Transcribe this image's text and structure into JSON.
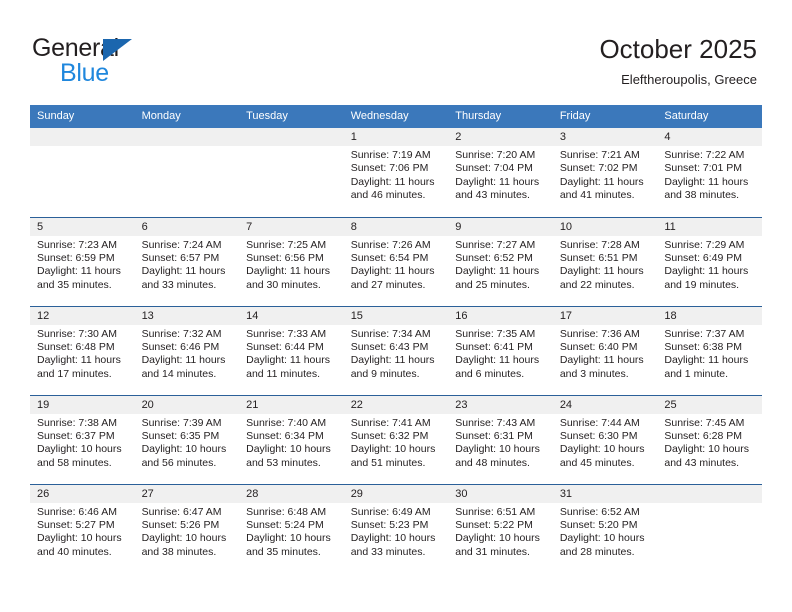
{
  "brand": {
    "name_part1": "General",
    "name_part2": "Blue",
    "triangle_color": "#1b66ae",
    "blue_text_color": "#1f87dd"
  },
  "header": {
    "title": "October 2025",
    "subtitle": "Eleftheroupolis, Greece",
    "header_bg_color": "#3b78bb",
    "row_divider_color": "#2b6099",
    "daynum_bg_color": "#f0f0f0"
  },
  "weekdays": [
    "Sunday",
    "Monday",
    "Tuesday",
    "Wednesday",
    "Thursday",
    "Friday",
    "Saturday"
  ],
  "weeks": [
    [
      {
        "day": "",
        "empty": true
      },
      {
        "day": "",
        "empty": true
      },
      {
        "day": "",
        "empty": true
      },
      {
        "day": "1",
        "sunrise": "Sunrise: 7:19 AM",
        "sunset": "Sunset: 7:06 PM",
        "daylight_l1": "Daylight: 11 hours",
        "daylight_l2": "and 46 minutes."
      },
      {
        "day": "2",
        "sunrise": "Sunrise: 7:20 AM",
        "sunset": "Sunset: 7:04 PM",
        "daylight_l1": "Daylight: 11 hours",
        "daylight_l2": "and 43 minutes."
      },
      {
        "day": "3",
        "sunrise": "Sunrise: 7:21 AM",
        "sunset": "Sunset: 7:02 PM",
        "daylight_l1": "Daylight: 11 hours",
        "daylight_l2": "and 41 minutes."
      },
      {
        "day": "4",
        "sunrise": "Sunrise: 7:22 AM",
        "sunset": "Sunset: 7:01 PM",
        "daylight_l1": "Daylight: 11 hours",
        "daylight_l2": "and 38 minutes."
      }
    ],
    [
      {
        "day": "5",
        "sunrise": "Sunrise: 7:23 AM",
        "sunset": "Sunset: 6:59 PM",
        "daylight_l1": "Daylight: 11 hours",
        "daylight_l2": "and 35 minutes."
      },
      {
        "day": "6",
        "sunrise": "Sunrise: 7:24 AM",
        "sunset": "Sunset: 6:57 PM",
        "daylight_l1": "Daylight: 11 hours",
        "daylight_l2": "and 33 minutes."
      },
      {
        "day": "7",
        "sunrise": "Sunrise: 7:25 AM",
        "sunset": "Sunset: 6:56 PM",
        "daylight_l1": "Daylight: 11 hours",
        "daylight_l2": "and 30 minutes."
      },
      {
        "day": "8",
        "sunrise": "Sunrise: 7:26 AM",
        "sunset": "Sunset: 6:54 PM",
        "daylight_l1": "Daylight: 11 hours",
        "daylight_l2": "and 27 minutes."
      },
      {
        "day": "9",
        "sunrise": "Sunrise: 7:27 AM",
        "sunset": "Sunset: 6:52 PM",
        "daylight_l1": "Daylight: 11 hours",
        "daylight_l2": "and 25 minutes."
      },
      {
        "day": "10",
        "sunrise": "Sunrise: 7:28 AM",
        "sunset": "Sunset: 6:51 PM",
        "daylight_l1": "Daylight: 11 hours",
        "daylight_l2": "and 22 minutes."
      },
      {
        "day": "11",
        "sunrise": "Sunrise: 7:29 AM",
        "sunset": "Sunset: 6:49 PM",
        "daylight_l1": "Daylight: 11 hours",
        "daylight_l2": "and 19 minutes."
      }
    ],
    [
      {
        "day": "12",
        "sunrise": "Sunrise: 7:30 AM",
        "sunset": "Sunset: 6:48 PM",
        "daylight_l1": "Daylight: 11 hours",
        "daylight_l2": "and 17 minutes."
      },
      {
        "day": "13",
        "sunrise": "Sunrise: 7:32 AM",
        "sunset": "Sunset: 6:46 PM",
        "daylight_l1": "Daylight: 11 hours",
        "daylight_l2": "and 14 minutes."
      },
      {
        "day": "14",
        "sunrise": "Sunrise: 7:33 AM",
        "sunset": "Sunset: 6:44 PM",
        "daylight_l1": "Daylight: 11 hours",
        "daylight_l2": "and 11 minutes."
      },
      {
        "day": "15",
        "sunrise": "Sunrise: 7:34 AM",
        "sunset": "Sunset: 6:43 PM",
        "daylight_l1": "Daylight: 11 hours",
        "daylight_l2": "and 9 minutes."
      },
      {
        "day": "16",
        "sunrise": "Sunrise: 7:35 AM",
        "sunset": "Sunset: 6:41 PM",
        "daylight_l1": "Daylight: 11 hours",
        "daylight_l2": "and 6 minutes."
      },
      {
        "day": "17",
        "sunrise": "Sunrise: 7:36 AM",
        "sunset": "Sunset: 6:40 PM",
        "daylight_l1": "Daylight: 11 hours",
        "daylight_l2": "and 3 minutes."
      },
      {
        "day": "18",
        "sunrise": "Sunrise: 7:37 AM",
        "sunset": "Sunset: 6:38 PM",
        "daylight_l1": "Daylight: 11 hours",
        "daylight_l2": "and 1 minute."
      }
    ],
    [
      {
        "day": "19",
        "sunrise": "Sunrise: 7:38 AM",
        "sunset": "Sunset: 6:37 PM",
        "daylight_l1": "Daylight: 10 hours",
        "daylight_l2": "and 58 minutes."
      },
      {
        "day": "20",
        "sunrise": "Sunrise: 7:39 AM",
        "sunset": "Sunset: 6:35 PM",
        "daylight_l1": "Daylight: 10 hours",
        "daylight_l2": "and 56 minutes."
      },
      {
        "day": "21",
        "sunrise": "Sunrise: 7:40 AM",
        "sunset": "Sunset: 6:34 PM",
        "daylight_l1": "Daylight: 10 hours",
        "daylight_l2": "and 53 minutes."
      },
      {
        "day": "22",
        "sunrise": "Sunrise: 7:41 AM",
        "sunset": "Sunset: 6:32 PM",
        "daylight_l1": "Daylight: 10 hours",
        "daylight_l2": "and 51 minutes."
      },
      {
        "day": "23",
        "sunrise": "Sunrise: 7:43 AM",
        "sunset": "Sunset: 6:31 PM",
        "daylight_l1": "Daylight: 10 hours",
        "daylight_l2": "and 48 minutes."
      },
      {
        "day": "24",
        "sunrise": "Sunrise: 7:44 AM",
        "sunset": "Sunset: 6:30 PM",
        "daylight_l1": "Daylight: 10 hours",
        "daylight_l2": "and 45 minutes."
      },
      {
        "day": "25",
        "sunrise": "Sunrise: 7:45 AM",
        "sunset": "Sunset: 6:28 PM",
        "daylight_l1": "Daylight: 10 hours",
        "daylight_l2": "and 43 minutes."
      }
    ],
    [
      {
        "day": "26",
        "sunrise": "Sunrise: 6:46 AM",
        "sunset": "Sunset: 5:27 PM",
        "daylight_l1": "Daylight: 10 hours",
        "daylight_l2": "and 40 minutes."
      },
      {
        "day": "27",
        "sunrise": "Sunrise: 6:47 AM",
        "sunset": "Sunset: 5:26 PM",
        "daylight_l1": "Daylight: 10 hours",
        "daylight_l2": "and 38 minutes."
      },
      {
        "day": "28",
        "sunrise": "Sunrise: 6:48 AM",
        "sunset": "Sunset: 5:24 PM",
        "daylight_l1": "Daylight: 10 hours",
        "daylight_l2": "and 35 minutes."
      },
      {
        "day": "29",
        "sunrise": "Sunrise: 6:49 AM",
        "sunset": "Sunset: 5:23 PM",
        "daylight_l1": "Daylight: 10 hours",
        "daylight_l2": "and 33 minutes."
      },
      {
        "day": "30",
        "sunrise": "Sunrise: 6:51 AM",
        "sunset": "Sunset: 5:22 PM",
        "daylight_l1": "Daylight: 10 hours",
        "daylight_l2": "and 31 minutes."
      },
      {
        "day": "31",
        "sunrise": "Sunrise: 6:52 AM",
        "sunset": "Sunset: 5:20 PM",
        "daylight_l1": "Daylight: 10 hours",
        "daylight_l2": "and 28 minutes."
      },
      {
        "day": "",
        "empty": true
      }
    ]
  ]
}
